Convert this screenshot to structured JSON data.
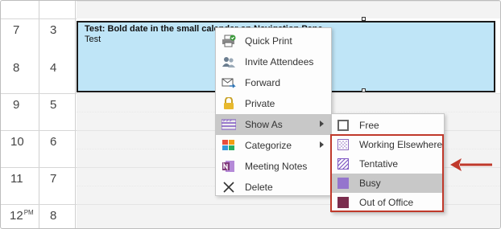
{
  "calendar": {
    "rows": [
      {
        "hour": "7",
        "ampm": "",
        "week": "3"
      },
      {
        "hour": "8",
        "ampm": "",
        "week": "4"
      },
      {
        "hour": "9",
        "ampm": "",
        "week": "5"
      },
      {
        "hour": "10",
        "ampm": "",
        "week": "6"
      },
      {
        "hour": "11",
        "ampm": "",
        "week": "7"
      },
      {
        "hour": "12",
        "ampm": "PM",
        "week": "8"
      }
    ]
  },
  "appointment": {
    "title": "Test: Bold date in the small calendar on Navigation Pane",
    "body": "Test",
    "color": "#bfe5f7"
  },
  "context_menu": {
    "items": [
      {
        "label": "Quick Print",
        "icon": "printer-icon"
      },
      {
        "label": "Invite Attendees",
        "icon": "people-icon"
      },
      {
        "label": "Forward",
        "icon": "forward-mail-icon"
      },
      {
        "label": "Private",
        "icon": "lock-icon"
      },
      {
        "label": "Show As",
        "icon": "show-as-icon",
        "has_submenu": true,
        "active": true
      },
      {
        "label": "Categorize",
        "icon": "categorize-icon",
        "has_submenu": true
      },
      {
        "label": "Meeting Notes",
        "icon": "onenote-icon"
      },
      {
        "label": "Delete",
        "icon": "delete-x-icon"
      }
    ]
  },
  "show_as_submenu": {
    "items": [
      {
        "label": "Free",
        "icon": "free-swatch-icon",
        "color": "#ffffff"
      },
      {
        "label": "Working Elsewhere",
        "icon": "working-elsewhere-swatch-icon",
        "color": "#9b59b6"
      },
      {
        "label": "Tentative",
        "icon": "tentative-swatch-icon",
        "color": "#7e57c2"
      },
      {
        "label": "Busy",
        "icon": "busy-swatch-icon",
        "color": "#9575cd",
        "active": true
      },
      {
        "label": "Out of Office",
        "icon": "out-of-office-swatch-icon",
        "color": "#7b2d4e"
      }
    ]
  },
  "colors": {
    "highlight": "#c0392b",
    "menu_active": "#c8c8c8"
  }
}
